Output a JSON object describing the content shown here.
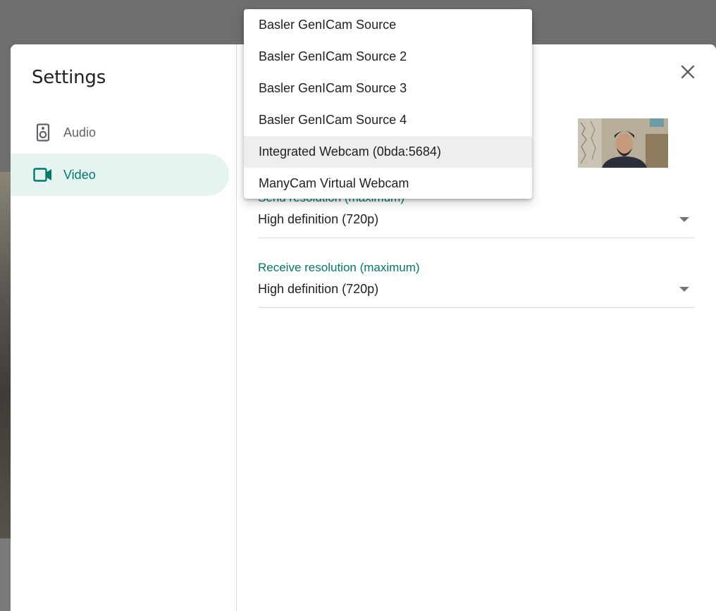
{
  "settings": {
    "title": "Settings",
    "nav": [
      {
        "label": "Audio",
        "icon": "speaker-icon"
      },
      {
        "label": "Video",
        "icon": "video-camera-icon",
        "active": true
      }
    ]
  },
  "camera_menu": {
    "options": [
      "Basler GenICam Source",
      "Basler GenICam Source 2",
      "Basler GenICam Source 3",
      "Basler GenICam Source 4",
      "Integrated Webcam (0bda:5684)",
      "ManyCam Virtual Webcam"
    ],
    "highlighted": "Integrated Webcam (0bda:5684)"
  },
  "send_resolution": {
    "label": "Send resolution (maximum)",
    "value": "High definition (720p)"
  },
  "receive_resolution": {
    "label": "Receive resolution (maximum)",
    "value": "High definition (720p)"
  },
  "colors": {
    "accent": "#00796b",
    "active_nav_bg": "#e6f4f1",
    "menu_highlight": "#eeeeee"
  }
}
